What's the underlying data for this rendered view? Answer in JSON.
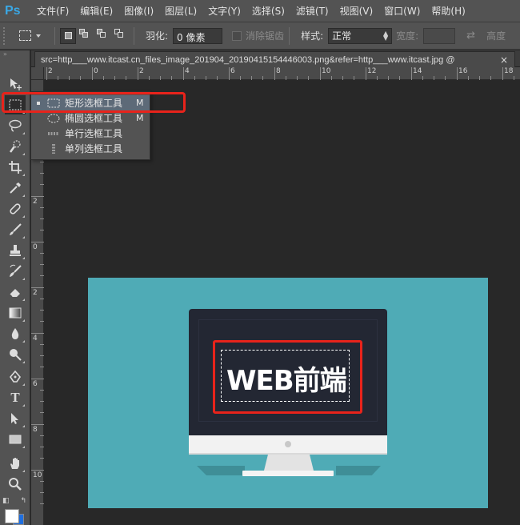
{
  "app": {
    "logo": "Ps"
  },
  "menubar": {
    "items": [
      "文件(F)",
      "编辑(E)",
      "图像(I)",
      "图层(L)",
      "文字(Y)",
      "选择(S)",
      "滤镜(T)",
      "视图(V)",
      "窗口(W)",
      "帮助(H)"
    ]
  },
  "options": {
    "feather_label": "羽化:",
    "feather_value": "0 像素",
    "antialias_label": "消除锯齿",
    "style_label": "样式:",
    "style_value": "正常",
    "width_label": "宽度:",
    "height_label": "高度"
  },
  "document": {
    "tab_title": "src=http___www.itcast.cn_files_image_201904_20190415154446003.png&refer=http___www.itcast.jpg @",
    "close": "×"
  },
  "rulers": {
    "h_labels": [
      "2",
      "0",
      "2",
      "4",
      "6",
      "8",
      "10",
      "12",
      "14",
      "16",
      "18"
    ],
    "v_labels": [
      "4",
      "2",
      "0",
      "2",
      "4",
      "6",
      "8",
      "10"
    ]
  },
  "flyout": {
    "items": [
      {
        "label": "矩形选框工具",
        "key": "M",
        "selected": true
      },
      {
        "label": "椭圆选框工具",
        "key": "M",
        "selected": false
      },
      {
        "label": "单行选框工具",
        "key": "",
        "selected": false
      },
      {
        "label": "单列选框工具",
        "key": "",
        "selected": false
      }
    ]
  },
  "artwork": {
    "text": "WEB前端"
  },
  "colors": {
    "accent_red": "#e8231b",
    "foreground": "#ffffff",
    "background": "#1f6fe0",
    "art_bg": "#4fabb6"
  }
}
